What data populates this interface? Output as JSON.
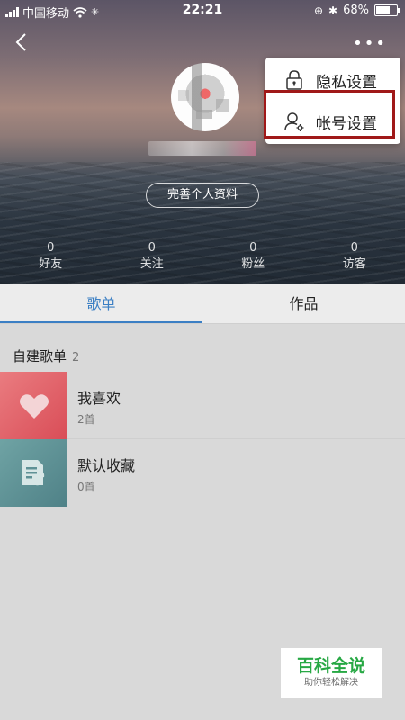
{
  "status_bar": {
    "carrier": "中国移动",
    "time": "22:21",
    "battery_percent": "68%",
    "battery_level": 0.68
  },
  "header": {
    "back_icon": "chevron-left-icon",
    "more_icon": "more-dots-icon"
  },
  "profile": {
    "complete_profile_label": "完善个人资料",
    "stats": [
      {
        "value": "0",
        "label": "好友"
      },
      {
        "value": "0",
        "label": "关注"
      },
      {
        "value": "0",
        "label": "粉丝"
      },
      {
        "value": "0",
        "label": "访客"
      }
    ]
  },
  "menu": {
    "items": [
      {
        "label": "隐私设置",
        "icon": "lock-icon"
      },
      {
        "label": "帐号设置",
        "icon": "user-settings-icon"
      }
    ],
    "highlight_color": "#a01818"
  },
  "tabs": [
    {
      "label": "歌单",
      "active": true
    },
    {
      "label": "作品",
      "active": false
    }
  ],
  "accent_color": "#3b7fc4",
  "playlists": {
    "section_title": "自建歌单",
    "count": "2",
    "items": [
      {
        "name": "我喜欢",
        "count": "2首",
        "icon": "heart-icon",
        "color": "#e0636b"
      },
      {
        "name": "默认收藏",
        "count": "0首",
        "icon": "music-note-icon",
        "color": "#5f9196"
      }
    ]
  },
  "watermark": {
    "title": "百科全说",
    "subtitle": "助你轻松解决"
  }
}
